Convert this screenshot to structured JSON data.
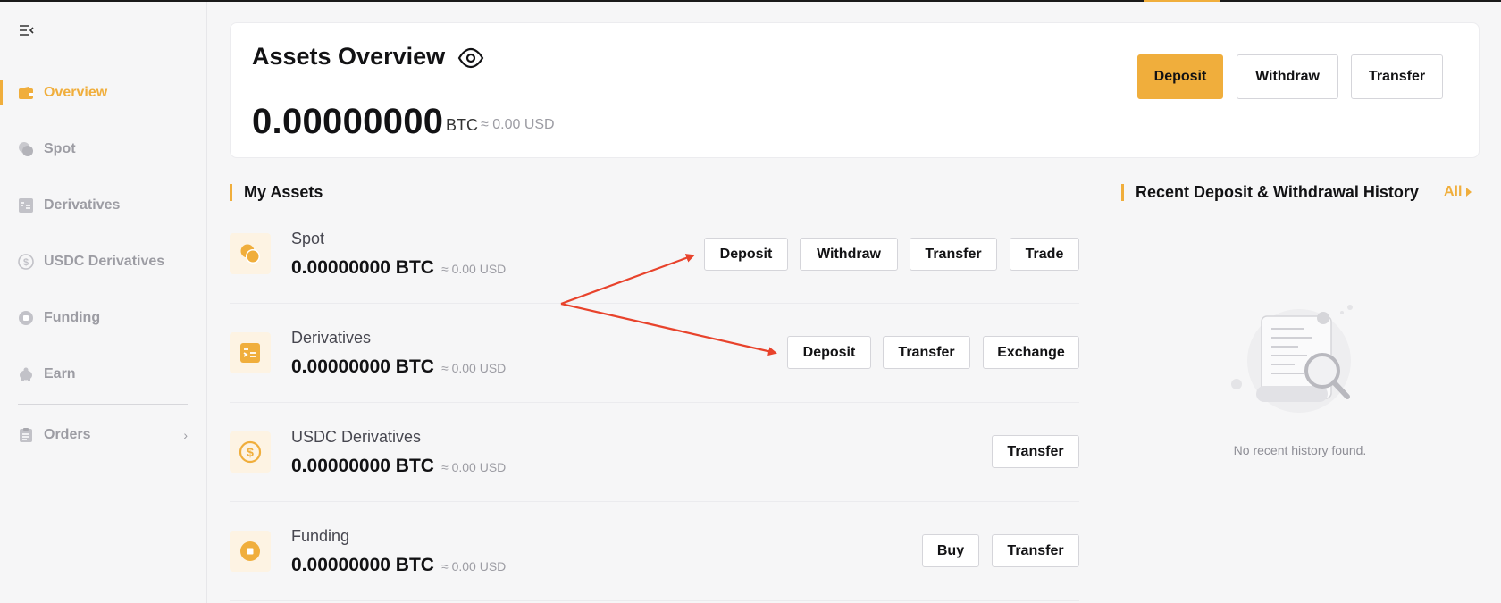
{
  "sidebar": {
    "items": [
      {
        "label": "Overview",
        "icon": "wallet-icon",
        "active": true
      },
      {
        "label": "Spot",
        "icon": "coins-icon"
      },
      {
        "label": "Derivatives",
        "icon": "ledger-icon"
      },
      {
        "label": "USDC Derivatives",
        "icon": "dollar-coin-icon"
      },
      {
        "label": "Funding",
        "icon": "funding-coin-icon"
      },
      {
        "label": "Earn",
        "icon": "piggy-bank-icon"
      }
    ],
    "orders": {
      "label": "Orders",
      "icon": "clipboard-icon"
    }
  },
  "overview": {
    "title": "Assets Overview",
    "balance": "0.00000000",
    "unit": "BTC",
    "usd": "≈ 0.00 USD",
    "buttons": {
      "deposit": "Deposit",
      "withdraw": "Withdraw",
      "transfer": "Transfer"
    }
  },
  "my_assets": {
    "title": "My Assets",
    "rows": [
      {
        "name": "Spot",
        "value": "0.00000000 BTC",
        "usd": "≈ 0.00 USD",
        "buttons": [
          "Deposit",
          "Withdraw",
          "Transfer",
          "Trade"
        ]
      },
      {
        "name": "Derivatives",
        "value": "0.00000000 BTC",
        "usd": "≈ 0.00 USD",
        "buttons": [
          "Deposit",
          "Transfer",
          "Exchange"
        ]
      },
      {
        "name": "USDC Derivatives",
        "value": "0.00000000 BTC",
        "usd": "≈ 0.00 USD",
        "buttons": [
          "Transfer"
        ]
      },
      {
        "name": "Funding",
        "value": "0.00000000 BTC",
        "usd": "≈ 0.00 USD",
        "buttons": [
          "Buy",
          "Transfer"
        ]
      }
    ]
  },
  "history": {
    "title": "Recent Deposit & Withdrawal History",
    "all_label": "All",
    "empty_text": "No recent history found."
  },
  "colors": {
    "accent": "#f0ae3c",
    "annotation": "#e8432c"
  }
}
